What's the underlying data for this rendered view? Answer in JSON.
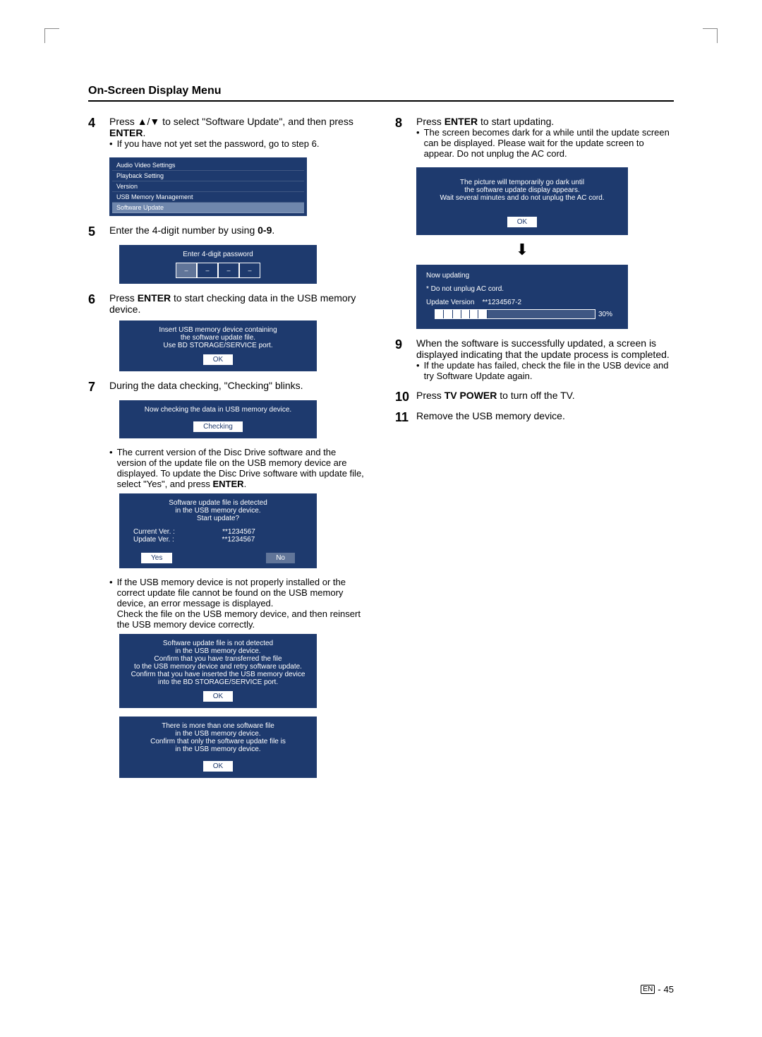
{
  "page": {
    "title": "On-Screen Display Menu",
    "footer_lang": "EN",
    "footer_sep": "-",
    "footer_num": "45"
  },
  "left": {
    "s4_num": "4",
    "s4_a": "Press ",
    "s4_b": " to select \"Software Update\", and then press ",
    "s4_enter": "ENTER",
    "s4_c": ".",
    "s4_bullet": "If you have not yet set the password, go to step 6.",
    "menu": {
      "r1": "Audio Video Settings",
      "r2": "Playback Setting",
      "r3": "Version",
      "r4": "USB Memory Management",
      "r5": "Software Update"
    },
    "s5_num": "5",
    "s5_a": "Enter the 4-digit number by using ",
    "s5_range": "0-9",
    "s5_b": ".",
    "pw_title": "Enter 4-digit password",
    "pw_d1": "–",
    "pw_d2": "–",
    "pw_d3": "–",
    "pw_d4": "–",
    "s6_num": "6",
    "s6_a": "Press ",
    "s6_enter": "ENTER",
    "s6_b": " to start checking data in the USB memory device.",
    "insert_l1": "Insert USB memory device containing",
    "insert_l2": "the software update file.",
    "insert_l3": "Use BD STORAGE/SERVICE port.",
    "insert_btn": "OK",
    "s7_num": "7",
    "s7_text": "During the data checking, \"Checking\" blinks.",
    "checking_l1": "Now checking the data in USB memory device.",
    "checking_btn": "Checking",
    "s7_bullet_a": "The current version of the Disc Drive software and the version of the update file on the USB memory device are displayed. To update the Disc Drive software with update file, select \"Yes\", and press ",
    "s7_bullet_enter": "ENTER",
    "s7_bullet_b": ".",
    "detect_l1": "Software update file is detected",
    "detect_l2": "in the USB memory device.",
    "detect_l3": "Start update?",
    "cur_label": "Current Ver. :",
    "cur_val": "**1234567",
    "upd_label": "Update Ver. :",
    "upd_val": "**1234567",
    "yes": "Yes",
    "no": "No",
    "s7_bullet2_a": "If the USB memory device is not properly installed or the correct update file cannot be found on the USB memory device, an error message is displayed.",
    "s7_bullet2_b": "Check the file on the USB memory device, and then reinsert the USB memory device correctly.",
    "err1_l1": "Software update file is not detected",
    "err1_l2": "in the USB memory device.",
    "err1_l3": "Confirm that you have transferred the file",
    "err1_l4": "to the USB memory device and retry software update.",
    "err1_l5": "Confirm that you have inserted the USB memory device",
    "err1_l6": "into the BD STORAGE/SERVICE port.",
    "err1_btn": "OK",
    "err2_l1": "There is more than one software file",
    "err2_l2": "in the USB memory device.",
    "err2_l3": "Confirm that only the software update file is",
    "err2_l4": "in the USB memory device.",
    "err2_btn": "OK"
  },
  "right": {
    "s8_num": "8",
    "s8_a": "Press ",
    "s8_enter": "ENTER",
    "s8_b": " to start updating.",
    "s8_bullet": "The screen becomes dark for a while until the update screen can be displayed. Please wait for the update screen to appear. Do not unplug the AC cord.",
    "dark_l1": "The picture will temporarily go dark until",
    "dark_l2": "the software update display appears.",
    "dark_l3": "Wait several minutes and do not unplug the AC cord.",
    "dark_btn": "OK",
    "arrow": "⬇",
    "upd_l1": "Now updating",
    "upd_l2": "* Do not unplug AC cord.",
    "upd_ver_label": "Update Version",
    "upd_ver_val": "**1234567-2",
    "upd_pct": "30%",
    "s9_num": "9",
    "s9_text": "When the software is successfully updated, a screen is displayed indicating that the update process is completed.",
    "s9_bullet": "If the update has failed, check the file in the USB device and try Software Update again.",
    "s10_num": "10",
    "s10_a": "Press ",
    "s10_tvpower": "TV POWER",
    "s10_b": " to turn off the TV.",
    "s11_num": "11",
    "s11_text": "Remove the USB memory device."
  }
}
